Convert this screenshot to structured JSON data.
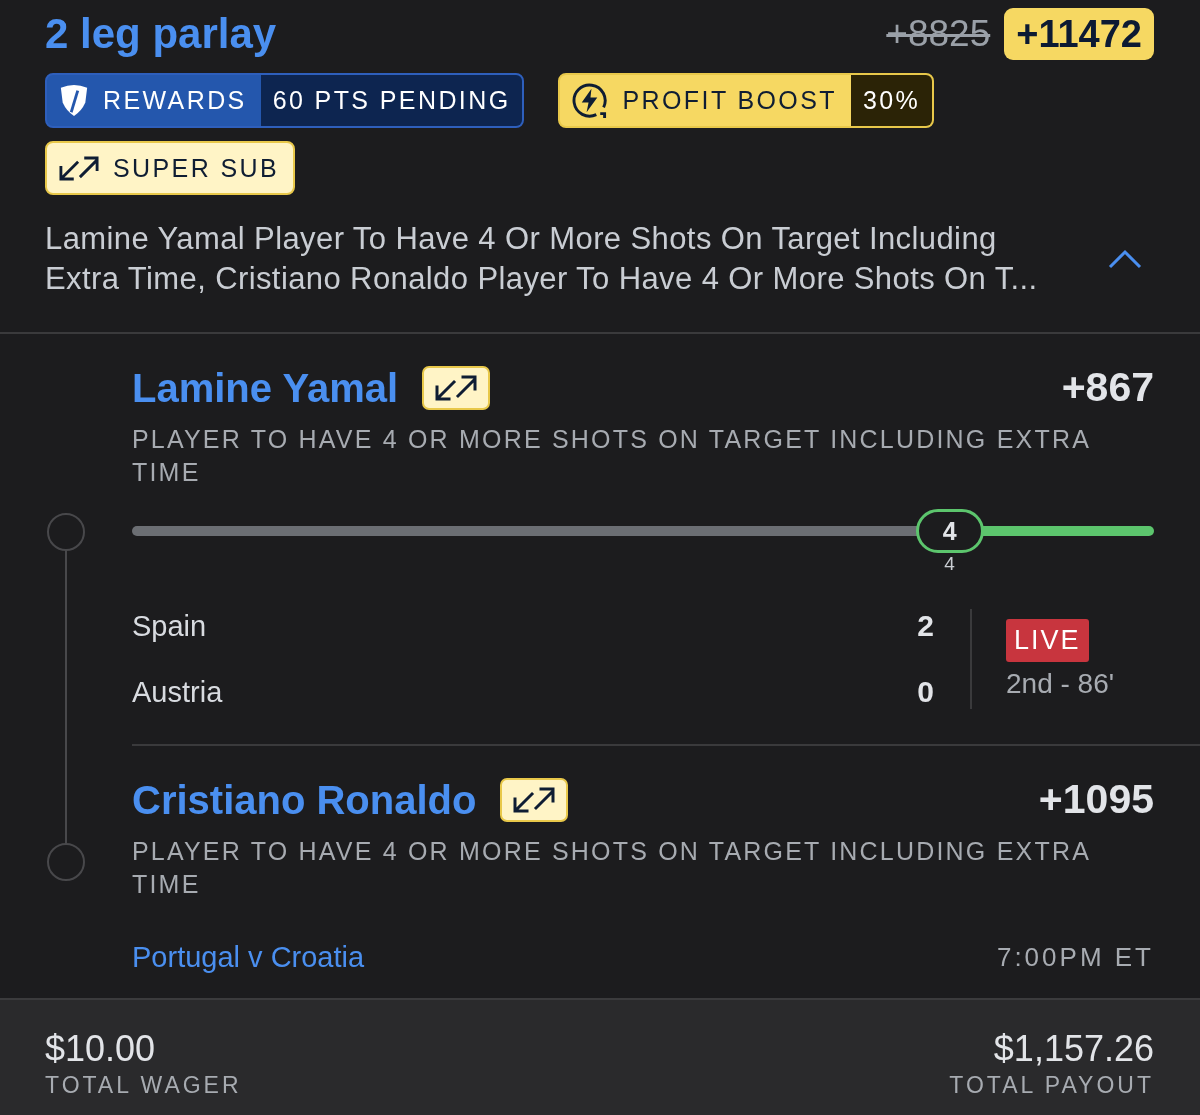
{
  "header": {
    "title": "2 leg parlay",
    "original_odds": "+8825",
    "boosted_odds": "+11472"
  },
  "promos": [
    {
      "kind": "rewards",
      "label": "REWARDS",
      "value": "60 PTS PENDING"
    },
    {
      "kind": "profit_boost",
      "label": "PROFIT BOOST",
      "value": "30%"
    },
    {
      "kind": "super_sub",
      "label": "SUPER SUB"
    }
  ],
  "summary": {
    "text": "Lamine Yamal Player To Have 4 Or More Shots On Target Including Extra Time, Cristiano Ronaldo Player To Have 4 Or More Shots On T...",
    "expanded": true
  },
  "legs": [
    {
      "player": "Lamine Yamal",
      "super_sub": true,
      "odds": "+867",
      "market": "PLAYER TO HAVE 4 OR MORE SHOTS ON TARGET INCLUDING EXTRA TIME",
      "tracker": {
        "current": "4",
        "target": "4",
        "level": 0.8
      },
      "score": {
        "teams": [
          {
            "name": "Spain",
            "score": "2"
          },
          {
            "name": "Austria",
            "score": "0"
          }
        ],
        "status": "LIVE",
        "clock": "2nd - 86'"
      }
    },
    {
      "player": "Cristiano Ronaldo",
      "super_sub": true,
      "odds": "+1095",
      "market": "PLAYER TO HAVE 4 OR MORE SHOTS ON TARGET INCLUDING EXTRA TIME",
      "event": "Portugal v Croatia",
      "start_time": "7:00PM ET"
    }
  ],
  "footer": {
    "wager": "$10.00",
    "wager_label": "TOTAL WAGER",
    "payout": "$1,157.26",
    "payout_label": "TOTAL PAYOUT"
  }
}
